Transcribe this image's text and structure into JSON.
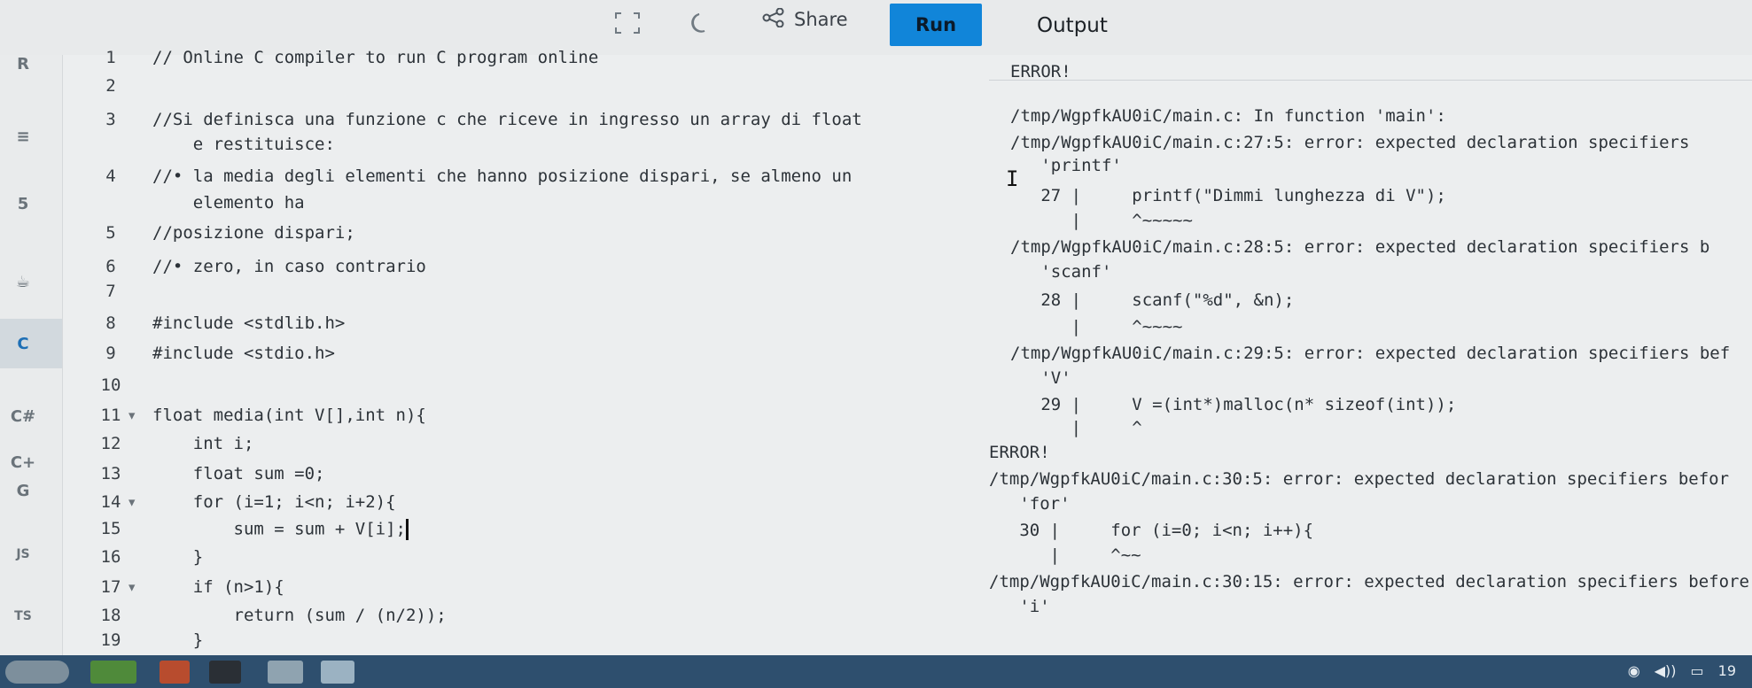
{
  "toolbar": {
    "fullscreen_icon": "fullscreen-icon",
    "theme_icon": "moon-icon",
    "share_label": "Share",
    "run_label": "Run",
    "output_label": "Output",
    "accent": "#1185d9"
  },
  "sidebar": {
    "items": [
      {
        "icon": "r-lang-icon",
        "glyph": "R"
      },
      {
        "icon": "database-icon",
        "glyph": "≡"
      },
      {
        "icon": "html5-icon",
        "glyph": "5"
      },
      {
        "icon": "java-icon",
        "glyph": "☕"
      },
      {
        "icon": "c-lang-icon",
        "glyph": "C"
      },
      {
        "icon": "csharp-icon",
        "glyph": "C#"
      },
      {
        "icon": "cpp-icon",
        "glyph": "C+"
      },
      {
        "icon": "go-icon",
        "glyph": "G"
      },
      {
        "icon": "javascript-icon",
        "glyph": "JS"
      },
      {
        "icon": "typescript-icon",
        "glyph": "TS"
      }
    ]
  },
  "editor": {
    "lines": [
      {
        "n": "1",
        "fold": "",
        "text": "// Online C compiler to run C program online"
      },
      {
        "n": "2",
        "fold": "",
        "text": ""
      },
      {
        "n": "3",
        "fold": "",
        "text": "//Si definisca una funzione c che riceve in ingresso un array di float"
      },
      {
        "n": "",
        "fold": "",
        "text": "    e restituisce:"
      },
      {
        "n": "4",
        "fold": "",
        "text": "//• la media degli elementi che hanno posizione dispari, se almeno un"
      },
      {
        "n": "",
        "fold": "",
        "text": "    elemento ha"
      },
      {
        "n": "5",
        "fold": "",
        "text": "//posizione dispari;"
      },
      {
        "n": "6",
        "fold": "",
        "text": "//• zero, in caso contrario"
      },
      {
        "n": "7",
        "fold": "",
        "text": ""
      },
      {
        "n": "8",
        "fold": "",
        "text": "#include <stdlib.h>"
      },
      {
        "n": "9",
        "fold": "",
        "text": "#include <stdio.h>"
      },
      {
        "n": "10",
        "fold": "",
        "text": ""
      },
      {
        "n": "11",
        "fold": "▾",
        "text": "float media(int V[],int n){"
      },
      {
        "n": "12",
        "fold": "",
        "text": "    int i;"
      },
      {
        "n": "13",
        "fold": "",
        "text": "    float sum =0;"
      },
      {
        "n": "14",
        "fold": "▾",
        "text": "    for (i=1; i<n; i+2){"
      },
      {
        "n": "15",
        "fold": "",
        "text": "        sum = sum + V[i];"
      },
      {
        "n": "16",
        "fold": "",
        "text": "    }"
      },
      {
        "n": "17",
        "fold": "▾",
        "text": "    if (n>1){"
      },
      {
        "n": "18",
        "fold": "",
        "text": "        return (sum / (n/2));"
      },
      {
        "n": "19",
        "fold": "",
        "text": "    }"
      }
    ]
  },
  "output": {
    "lines": [
      "ERROR!",
      "/tmp/WgpfkAU0iC/main.c: In function 'main':",
      "/tmp/WgpfkAU0iC/main.c:27:5: error: expected declaration specifiers",
      "   'printf'",
      "   27 |     printf(\"Dimmi lunghezza di V\");",
      "      |     ^~~~~~",
      "/tmp/WgpfkAU0iC/main.c:28:5: error: expected declaration specifiers b",
      "   'scanf'",
      "   28 |     scanf(\"%d\", &n);",
      "      |     ^~~~~",
      "/tmp/WgpfkAU0iC/main.c:29:5: error: expected declaration specifiers bef",
      "   'V'",
      "   29 |     V =(int*)malloc(n* sizeof(int));",
      "      |     ^",
      "ERROR!",
      "/tmp/WgpfkAU0iC/main.c:30:5: error: expected declaration specifiers befor",
      "   'for'",
      "   30 |     for (i=0; i<n; i++){",
      "      |     ^~~",
      "/tmp/WgpfkAU0iC/main.c:30:15: error: expected declaration specifiers before",
      "   'i'"
    ]
  },
  "taskbar": {
    "items": [
      "start-icon",
      "files-icon",
      "app-icon",
      "terminal-icon",
      "folder-icon",
      "window-icon"
    ],
    "tray": [
      "network-icon",
      "volume-icon",
      "battery-icon"
    ],
    "clock": "19"
  }
}
